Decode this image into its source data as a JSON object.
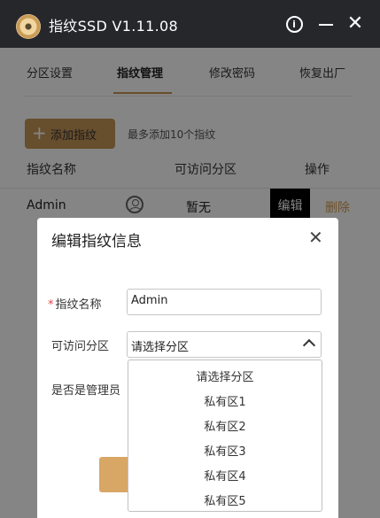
{
  "window": {
    "title": "指纹SSD V1.11.08",
    "icons": [
      "app-disk-icon",
      "info-icon",
      "minimize-icon",
      "close-icon"
    ]
  },
  "tabs": [
    {
      "label": "分区设置",
      "active": false
    },
    {
      "label": "指纹管理",
      "active": true
    },
    {
      "label": "修改密码",
      "active": false
    },
    {
      "label": "恢复出厂",
      "active": false
    }
  ],
  "fingerprint": {
    "add_button": "添加指纹",
    "add_hint": "最多添加10个指纹",
    "columns": [
      "指纹名称",
      "可访问分区",
      "操作"
    ],
    "rows": [
      {
        "name": "Admin",
        "partition": "暂无",
        "edit": "编辑",
        "delete": "删除"
      }
    ]
  },
  "dialog": {
    "title": "编辑指纹信息",
    "name_label": "指纹名称",
    "name_value": "Admin",
    "partition_label": "可访问分区",
    "partition_selected": "请选择分区",
    "admin_label": "是否是管理员",
    "dropdown_options": [
      "请选择分区",
      "私有区1",
      "私有区2",
      "私有区3",
      "私有区4",
      "私有区5"
    ]
  },
  "colors": {
    "accent": "#c69656",
    "titlebar": "#26272b",
    "required": "#e04b4b"
  }
}
